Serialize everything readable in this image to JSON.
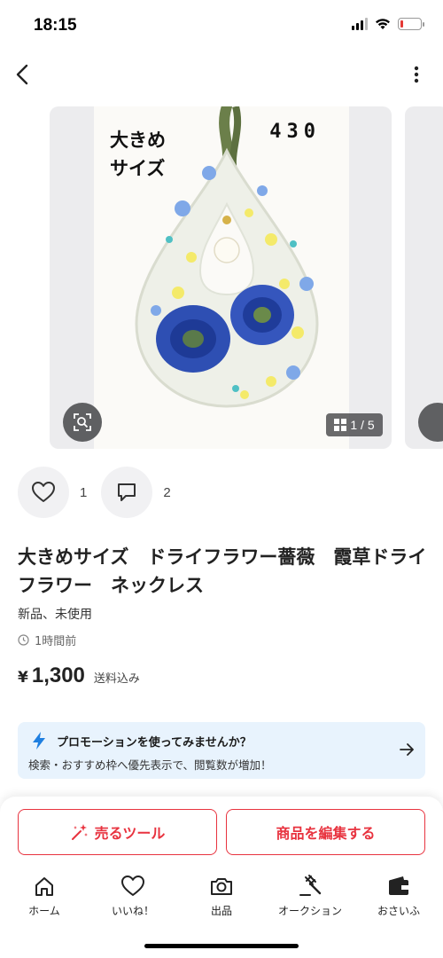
{
  "status_bar": {
    "time": "18:15",
    "battery_level": 0.15,
    "battery_color": "#e53935"
  },
  "nav": {
    "back_icon": "chevron-left-icon",
    "more_icon": "vertical-ellipsis-icon"
  },
  "gallery": {
    "overlay_text": "大きめ\nサイズ",
    "overlay_number": "430",
    "counter": "1 / 5",
    "lens_icon": "image-search-icon",
    "counter_icon": "grid-icon"
  },
  "actions": {
    "likes": "1",
    "comments": "2"
  },
  "item": {
    "title": "大きめサイズ　ドライフラワー薔薇　霞草ドライフラワー　ネックレス",
    "condition": "新品、未使用",
    "posted": "1時間前",
    "currency": "¥",
    "price": "1,300",
    "shipping": "送料込み"
  },
  "promo": {
    "title": "プロモーションを使ってみませんか？",
    "description": "検索・おすすめ枠へ優先表示で、閲覧数が増加！",
    "accent": "#1f7fe0"
  },
  "buttons": {
    "sell_tool": "売るツール",
    "edit_item": "商品を編集する",
    "accent": "#e8333f"
  },
  "tabs": [
    {
      "label": "ホーム",
      "icon": "home-icon"
    },
    {
      "label": "いいね！",
      "icon": "heart-icon"
    },
    {
      "label": "出品",
      "icon": "camera-icon"
    },
    {
      "label": "オークション",
      "icon": "gavel-icon"
    },
    {
      "label": "おさいふ",
      "icon": "wallet-icon"
    }
  ]
}
